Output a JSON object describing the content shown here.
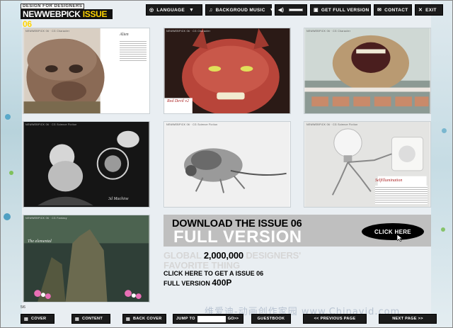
{
  "header": {
    "logo_small": "DESIGN FOR DESIGNERS",
    "logo_main": "NEWWEBPICK",
    "logo_issue": "ISSUE 06"
  },
  "topbar": {
    "language": {
      "icon": "globe-icon",
      "label": "LANGUAGE"
    },
    "music": {
      "icon": "music-icon",
      "label": "BACKGROUD MUSIC"
    },
    "volume": {
      "icon": "speaker-icon",
      "level": 0.0
    },
    "full_version": {
      "icon": "download-icon",
      "label": "GET FULL VERSION"
    },
    "contact": {
      "icon": "mail-icon",
      "label": "CONTACT"
    },
    "exit": {
      "icon": "close-icon",
      "label": "EXIT"
    }
  },
  "panels": [
    {
      "caption": "Alien",
      "tag": "NEWWEBPICK 06 · CG Character"
    },
    {
      "caption": "Red Devil v2",
      "tag": "NEWWEBPICK 06 · CG Character"
    },
    {
      "caption": "",
      "tag": "NEWWEBPICK 06 · CG Character"
    },
    {
      "caption": "3d Machine",
      "tag": "NEWWEBPICK 06 · CG Science Fiction"
    },
    {
      "caption": "",
      "tag": "NEWWEBPICK 06 · CG Science Fiction"
    },
    {
      "caption": "Selfillumination",
      "tag": "NEWWEBPICK 06 · CG Science Fiction"
    },
    {
      "caption": "The elemental",
      "tag": "NEWWEBPICK 06 · CG Fantasy"
    }
  ],
  "promo": {
    "line1": "DOWNLOAD THE ISSUE 06",
    "line2": "FULL VERSION",
    "button": "CLICK HERE",
    "global_pre": "GLOBAL",
    "global_num": "2,000,000",
    "global_post": "DESIGNERS'",
    "favorite": "FAVORITE THING",
    "click_line": "CLICK HERE TO GET A ISSUE 06",
    "full_pre": "FULL VERSION",
    "full_pages": "400P"
  },
  "footer": {
    "page_number": "5/6",
    "cover": {
      "icon": "book-icon",
      "label": "COVER"
    },
    "content": {
      "icon": "list-icon",
      "label": "CONTENT"
    },
    "back_cover": {
      "icon": "book-icon",
      "label": "BACK COVER"
    },
    "jump_label": "JUMP TO",
    "jump_value": "",
    "go_label": "GO>>",
    "guestbook": "GUESTBOOK",
    "prev": "<< PREVIOUS PAGE",
    "next": "NEXT PAGE >>",
    "watermark": "维爱迪-动画创作家园 www.Chinavid.com"
  },
  "colors": {
    "bar": "#1b1b1b",
    "accent": "#ffd400",
    "promo_band": "#bfbfbf"
  }
}
